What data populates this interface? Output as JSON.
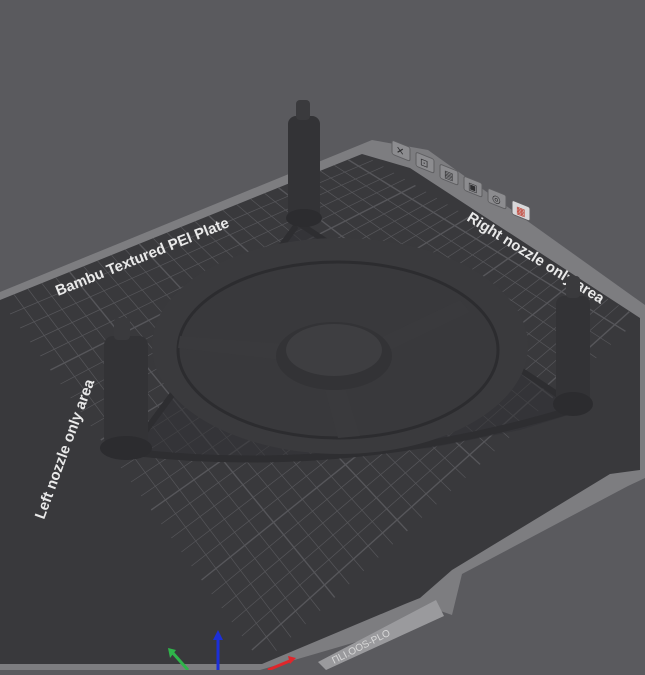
{
  "viewport": {
    "background": "#5a5a5e",
    "plate": {
      "name": "Bambu Textured PEI Plate",
      "label_right": "Right nozzle only area",
      "label_left": "Left nozzle only area",
      "plate_color": "#39393c",
      "rim_color": "#7d7d80",
      "grid_color": "#56565a",
      "label_color": "#e9e9e9"
    },
    "plate_buttons": [
      {
        "name": "close-icon",
        "glyph": "✕"
      },
      {
        "name": "arrange-icon",
        "glyph": "⊡"
      },
      {
        "name": "lock-icon",
        "glyph": "▤"
      },
      {
        "name": "orient-icon",
        "glyph": "▣"
      },
      {
        "name": "settings-icon",
        "glyph": "◎"
      },
      {
        "name": "plate-settings-icon",
        "glyph": "▦"
      }
    ],
    "model": {
      "description_hidden": "",
      "color": "#3a3a3d",
      "highlight_color": "#4a4a4e",
      "shadow_color": "#2a2a2c"
    },
    "axes": {
      "x_color": "#e0262b",
      "y_color": "#2fb44a",
      "z_color": "#1c2fd8"
    },
    "plate_badge": {
      "text": "ПLI.OOS-PLO"
    }
  }
}
